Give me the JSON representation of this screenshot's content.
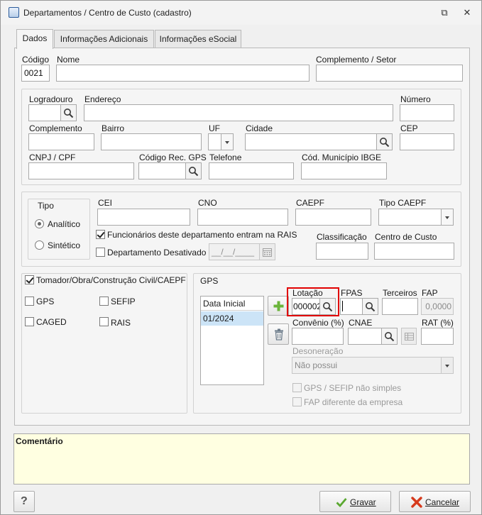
{
  "window": {
    "title": "Departamentos / Centro de Custo (cadastro)",
    "restore_glyph": "⧉",
    "close_glyph": "✕"
  },
  "tabs": [
    {
      "label": "Dados",
      "active": true
    },
    {
      "label": "Informações Adicionais",
      "active": false
    },
    {
      "label": "Informações eSocial",
      "active": false
    }
  ],
  "top": {
    "codigo_label": "Código",
    "codigo_value": "0021",
    "nome_label": "Nome",
    "nome_value": "",
    "complemento_setor_label": "Complemento / Setor",
    "complemento_setor_value": ""
  },
  "endereco": {
    "logradouro_label": "Logradouro",
    "logradouro_value": "",
    "endereco_label": "Endereço",
    "endereco_value": "",
    "numero_label": "Número",
    "numero_value": "",
    "complemento_label": "Complemento",
    "complemento_value": "",
    "bairro_label": "Bairro",
    "bairro_value": "",
    "uf_label": "UF",
    "uf_value": "",
    "cidade_label": "Cidade",
    "cidade_value": "",
    "cep_label": "CEP",
    "cep_value": "",
    "cnpj_label": "CNPJ / CPF",
    "cnpj_value": "",
    "cod_rec_gps_label": "Código Rec. GPS",
    "cod_rec_gps_value": "",
    "telefone_label": "Telefone",
    "telefone_value": "",
    "cod_municipio_label": "Cód. Município IBGE",
    "cod_municipio_value": ""
  },
  "tipo": {
    "group_label": "Tipo",
    "options": [
      {
        "label": "Analítico",
        "selected": true
      },
      {
        "label": "Sintético",
        "selected": false
      }
    ],
    "cei_label": "CEI",
    "cei_value": "",
    "cno_label": "CNO",
    "cno_value": "",
    "caepf_label": "CAEPF",
    "caepf_value": "",
    "tipo_caepf_label": "Tipo CAEPF",
    "tipo_caepf_value": "",
    "rais_check_label": "Funcionários deste departamento entram na RAIS",
    "rais_check": true,
    "desativado_label": "Departamento Desativado",
    "desativado_check": false,
    "desativado_date": "__/__/____",
    "classificacao_label": "Classificação",
    "classificacao_value": "",
    "centro_custo_label": "Centro de Custo",
    "centro_custo_value": ""
  },
  "flags": {
    "tomador_label": "Tomador/Obra/Construção Civil/CAEPF",
    "tomador": true,
    "gps_label": "GPS",
    "gps": false,
    "sefip_label": "SEFIP",
    "sefip": false,
    "caged_label": "CAGED",
    "caged": false,
    "rais_label": "RAIS",
    "rais": false
  },
  "gps": {
    "group_label": "GPS",
    "list_header": "Data Inicial",
    "list_rows": [
      "01/2024"
    ],
    "lotacao_label": "Lotação",
    "lotacao_value": "000002",
    "fpas_label": "FPAS",
    "fpas_value": "",
    "terceiros_label": "Terceiros",
    "terceiros_value": "",
    "fap_label": "FAP",
    "fap_value": "0,0000",
    "convenio_label": "Convênio (%)",
    "convenio_value": "",
    "cnae_label": "CNAE",
    "cnae_value": "",
    "rat_label": "RAT (%)",
    "rat_value": "",
    "desoneracao_label": "Desoneração",
    "desoneracao_value": "Não possui",
    "gps_sefip_label": "GPS / SEFIP não simples",
    "fap_diferente_label": "FAP diferente da empresa",
    "highlight_color": "#e10000"
  },
  "comentario": {
    "label": "Comentário",
    "value": "",
    "bg_color": "#ffffe1"
  },
  "footer": {
    "help_label": "?",
    "gravar_label": "Gravar",
    "cancelar_label": "Cancelar"
  }
}
